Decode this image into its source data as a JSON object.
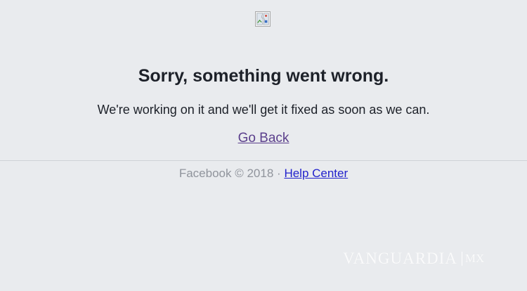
{
  "page": {
    "logo_alt_icon": "broken-image-icon",
    "title": "Sorry, something went wrong.",
    "message": "We're working on it and we'll get it fixed as soon as we can.",
    "go_back_label": "Go Back"
  },
  "footer": {
    "brand": "Facebook © 2018",
    "separator": "·",
    "help_center_label": "Help Center"
  },
  "watermark": {
    "text": "VANGUARDIA",
    "suffix": "MX"
  },
  "colors": {
    "background": "#e9ebee",
    "visited_link": "#5b3f8c",
    "link": "#2222cc",
    "muted_text": "#90949c"
  }
}
